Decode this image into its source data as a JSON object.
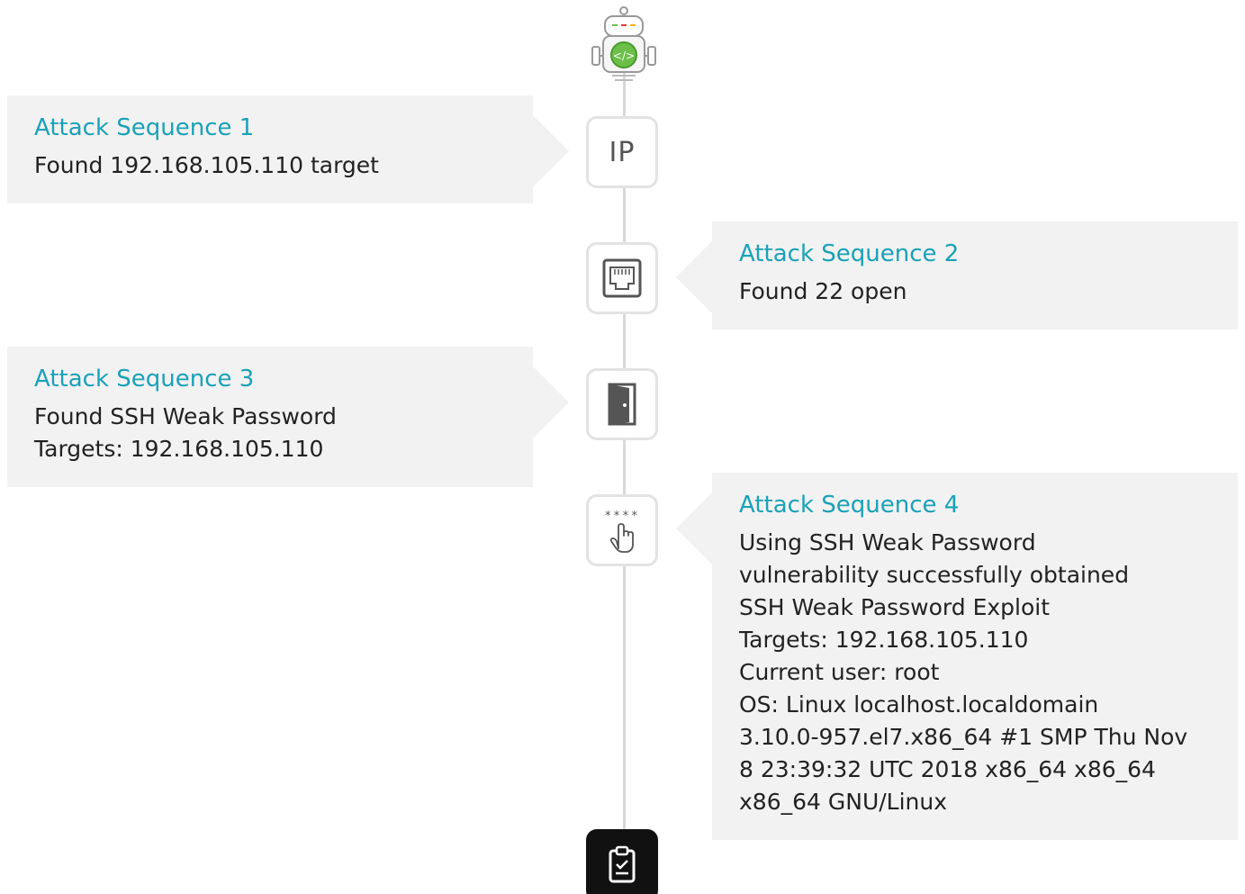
{
  "timeline": {
    "nodes": [
      {
        "id": "ip",
        "label": "IP"
      },
      {
        "id": "port",
        "icon": "ethernet-port-icon"
      },
      {
        "id": "door",
        "icon": "door-icon"
      },
      {
        "id": "password",
        "icon": "password-touch-icon",
        "mask": "****"
      },
      {
        "id": "report",
        "icon": "clipboard-check-icon"
      }
    ]
  },
  "sequences": [
    {
      "title": "Attack Sequence 1",
      "lines": [
        "Found 192.168.105.110 target"
      ]
    },
    {
      "title": "Attack Sequence 2",
      "lines": [
        "Found 22 open"
      ]
    },
    {
      "title": "Attack Sequence 3",
      "lines": [
        "Found SSH Weak Password",
        "Targets: 192.168.105.110"
      ]
    },
    {
      "title": "Attack Sequence 4",
      "lines": [
        "Using SSH Weak Password",
        "vulnerability successfully obtained",
        "SSH Weak Password Exploit",
        "Targets: 192.168.105.110",
        "Current user: root",
        "OS: Linux localhost.localdomain",
        "3.10.0-957.el7.x86_64 #1 SMP Thu Nov",
        "8 23:39:32 UTC 2018 x86_64 x86_64",
        "x86_64 GNU/Linux"
      ]
    }
  ],
  "colors": {
    "title": "#1aa1b8",
    "card_bg": "#f2f2f2",
    "line": "#d9d9d9",
    "robot_accent": "#6cc04a"
  }
}
